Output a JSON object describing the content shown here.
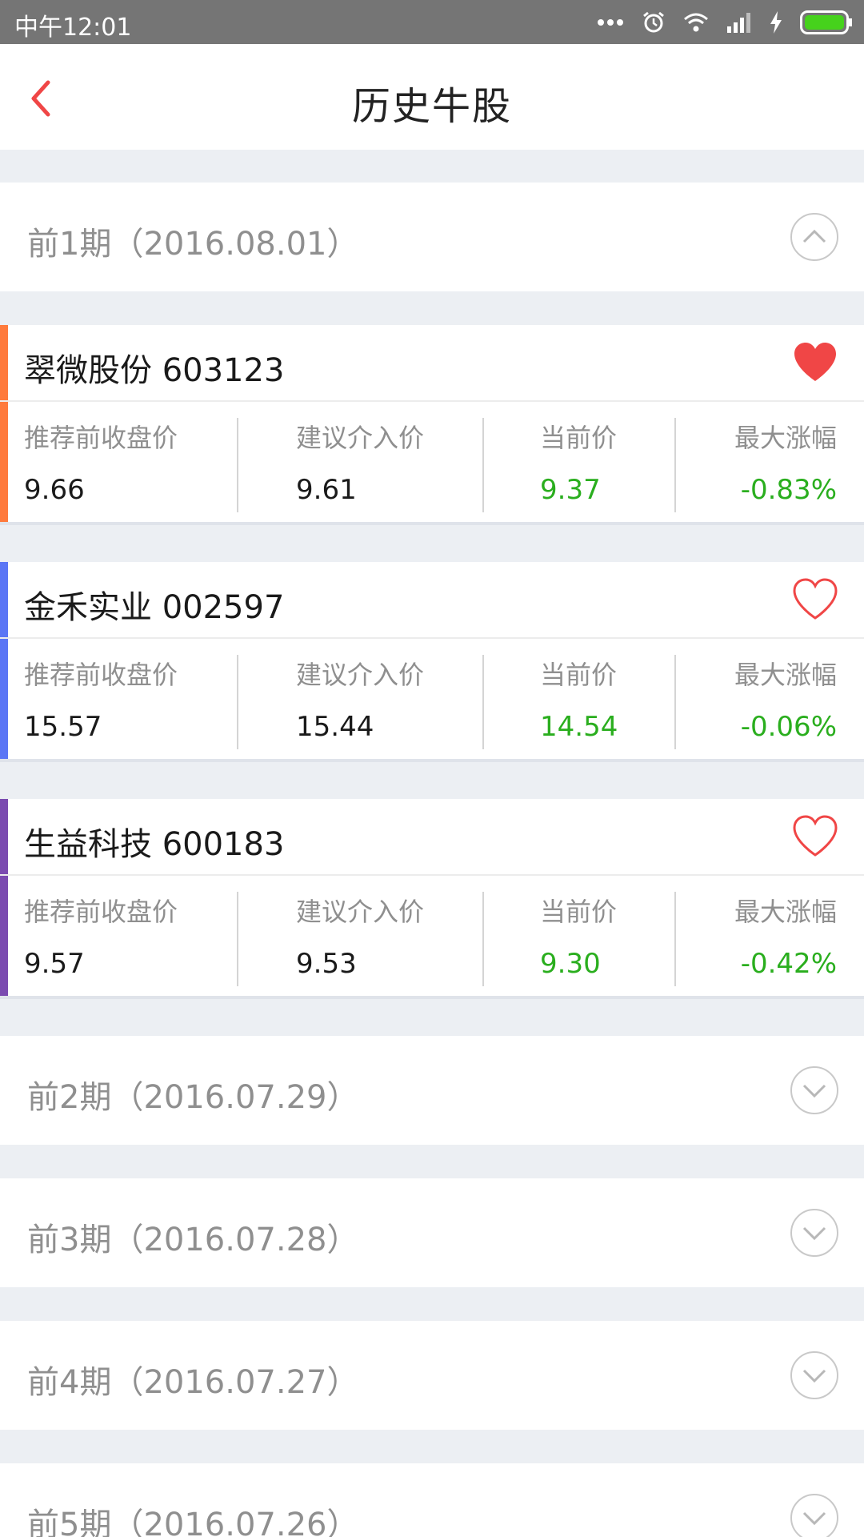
{
  "status_bar": {
    "time": "中午12:01"
  },
  "header": {
    "title": "历史牛股"
  },
  "colors": {
    "accent_red": "#f04646",
    "rise_green": "#2aae1e",
    "stripe_orange": "#ff7a3c",
    "stripe_blue": "#5b76f5",
    "stripe_purple": "#7b4bb0"
  },
  "periods": [
    {
      "title": "前1期（2016.08.01）",
      "expanded": true,
      "toggle_icon": "chevron-up-icon"
    },
    {
      "title": "前2期（2016.07.29）",
      "expanded": false,
      "toggle_icon": "chevron-down-icon"
    },
    {
      "title": "前3期（2016.07.28）",
      "expanded": false,
      "toggle_icon": "chevron-down-icon"
    },
    {
      "title": "前4期（2016.07.27）",
      "expanded": false,
      "toggle_icon": "chevron-down-icon"
    },
    {
      "title": "前5期（2016.07.26）",
      "expanded": false,
      "toggle_icon": "chevron-down-icon"
    }
  ],
  "column_labels": {
    "prev_close": "推荐前收盘价",
    "entry_price": "建议介入价",
    "current_price": "当前价",
    "max_gain": "最大涨幅"
  },
  "stocks": [
    {
      "name": "翠微股份 603123",
      "favorited": true,
      "prev_close": "9.66",
      "entry_price": "9.61",
      "current_price": "9.37",
      "max_gain": "-0.83%"
    },
    {
      "name": "金禾实业 002597",
      "favorited": false,
      "prev_close": "15.57",
      "entry_price": "15.44",
      "current_price": "14.54",
      "max_gain": "-0.06%"
    },
    {
      "name": "生益科技 600183",
      "favorited": false,
      "prev_close": "9.57",
      "entry_price": "9.53",
      "current_price": "9.30",
      "max_gain": "-0.42%"
    }
  ]
}
